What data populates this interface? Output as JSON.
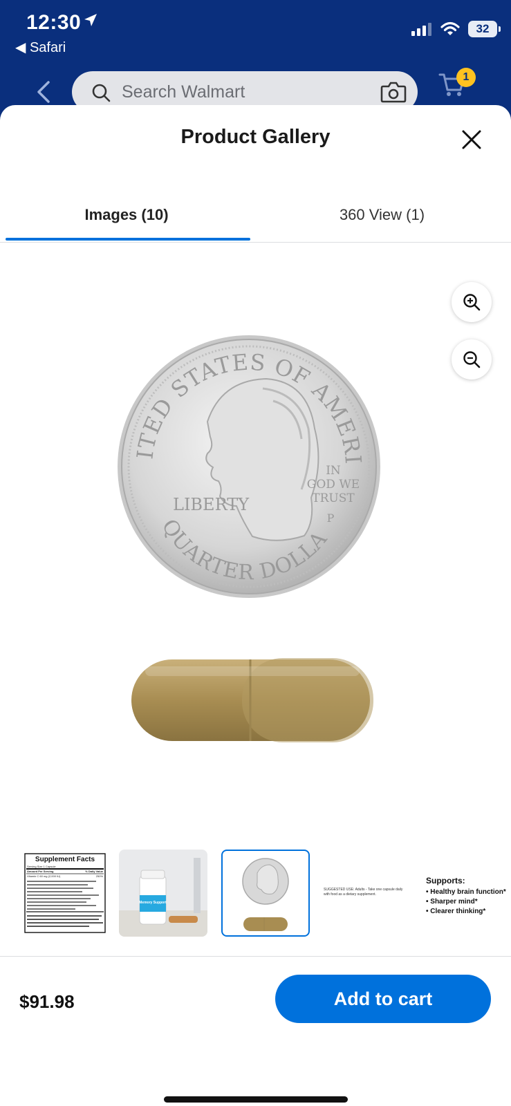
{
  "status": {
    "time": "12:30",
    "back_app": "◀ Safari",
    "battery": "32"
  },
  "header": {
    "search_placeholder": "Search Walmart",
    "cart_count": "1"
  },
  "sheet": {
    "title": "Product Gallery",
    "tabs": [
      {
        "label": "Images (10)",
        "active": true
      },
      {
        "label": "360 View (1)",
        "active": false
      }
    ]
  },
  "main_image": {
    "coin_top": "UNITED STATES OF AMERICA",
    "coin_liberty": "LIBERTY",
    "coin_motto": [
      "IN",
      "GOD WE",
      "TRUST"
    ],
    "coin_mint": "P",
    "coin_bottom": "QUARTER DOLLAR"
  },
  "thumbnails": {
    "supplement_facts": {
      "title": "Supplement Facts",
      "serving": "Serving Size 1 Capsule",
      "header_left": "Amount Per Serving",
      "header_right": "% Daily Value",
      "row1_left": "Vitamin C 60 mg (2,000 IU)",
      "row1_right": "250%"
    },
    "bottle_label": "Memory Support",
    "usage_text": "SUGGESTED USE: Adults - Take one capsule daily with food as a dietary supplement.",
    "supports_title": "Supports:",
    "supports_items": [
      "• Healthy brain function*",
      "• Sharper mind*",
      "• Clearer thinking*"
    ]
  },
  "footer": {
    "price": "$91.98",
    "add_to_cart": "Add to cart"
  },
  "colors": {
    "brand_blue": "#0a2f7d",
    "accent_blue": "#0071dc",
    "badge_yellow": "#ffc220"
  }
}
